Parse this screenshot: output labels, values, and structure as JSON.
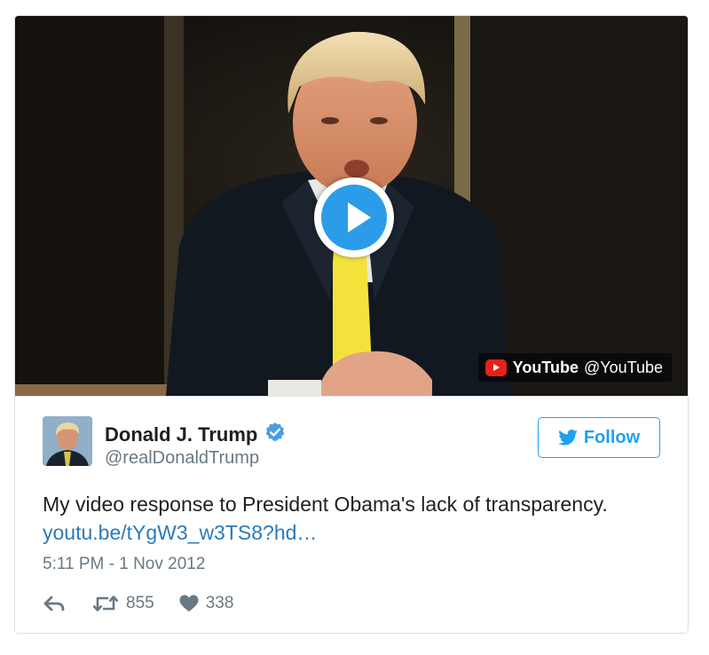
{
  "media": {
    "provider_name": "YouTube",
    "provider_handle": "@YouTube",
    "play_icon": "play-icon",
    "provider_icon": "youtube-icon"
  },
  "tweet": {
    "user_name": "Donald J. Trump",
    "screen_name": "@realDonaldTrump",
    "follow_label": "Follow",
    "text": "My video response to President Obama's lack of transparency.",
    "link": "youtu.be/tYgW3_w3TS8?hd…",
    "timestamp": "5:11 PM - 1 Nov 2012",
    "retweet_count": "855",
    "like_count": "338"
  },
  "colors": {
    "accent": "#1da1f2",
    "link": "#2b7bb9",
    "text": "#1c2022",
    "muted": "#697882",
    "youtube_red": "#e62117",
    "tie": "#f4e23c"
  },
  "icons": {
    "verified": "verified-badge-icon",
    "bird": "twitter-bird-icon",
    "reply": "reply-icon",
    "retweet": "retweet-icon",
    "like": "heart-icon"
  }
}
